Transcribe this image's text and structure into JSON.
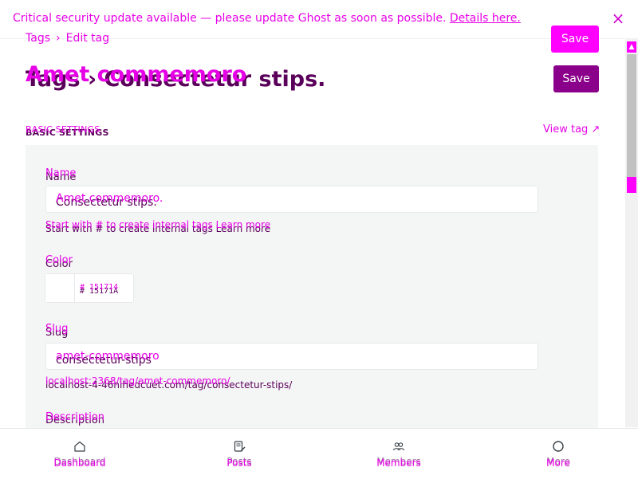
{
  "notice": {
    "text": "Critical security update available — please update Ghost as soon as possible.",
    "link": "Details here."
  },
  "breadcrumb": {
    "root": "Tags",
    "current": "Edit tag"
  },
  "buttons": {
    "overlay_save": "Save",
    "save": "Save"
  },
  "title": {
    "overlay": "Amet commemoro",
    "main": "Tags › Consectetur stips."
  },
  "section": {
    "label_a": "BASIC SETTINGS",
    "label_b": "BASIC SETTINGS",
    "view_tag": "View tag ↗"
  },
  "fields": {
    "name": {
      "label_a": "Name",
      "label_b": "Name",
      "value_a": "Amet commemoro.",
      "value_b": "Consectetur stips.",
      "hint_a": "Start with # to create internal tags Learn more",
      "hint_b": "Start with # to create internal tags Learn more"
    },
    "color": {
      "label_a": "Color",
      "label_b": "Color",
      "value_a": "# 151714",
      "value_b": "# 15171A"
    },
    "slug": {
      "label_a": "Slug",
      "label_b": "Slug",
      "value_a": "amet-commemoro",
      "value_b": "consectetur-stips",
      "url_a": "localhost:2368/tag/amet-commemoro/",
      "url_b": "localhost-4-46nihedcuet.com/tag/consectetur-stips/"
    },
    "description": {
      "label_a": "Description",
      "label_b": "Description"
    }
  },
  "bottom_nav": [
    {
      "label": "Dashboard",
      "icon": "home-icon"
    },
    {
      "label": "Posts",
      "icon": "edit-icon"
    },
    {
      "label": "Members",
      "icon": "users-icon"
    },
    {
      "label": "More",
      "icon": "circle-icon"
    }
  ],
  "colors": {
    "accent": "#ff00ff",
    "save_button": "#8a008a",
    "panel": "#f4f5f5",
    "text_dark": "#15171a"
  }
}
